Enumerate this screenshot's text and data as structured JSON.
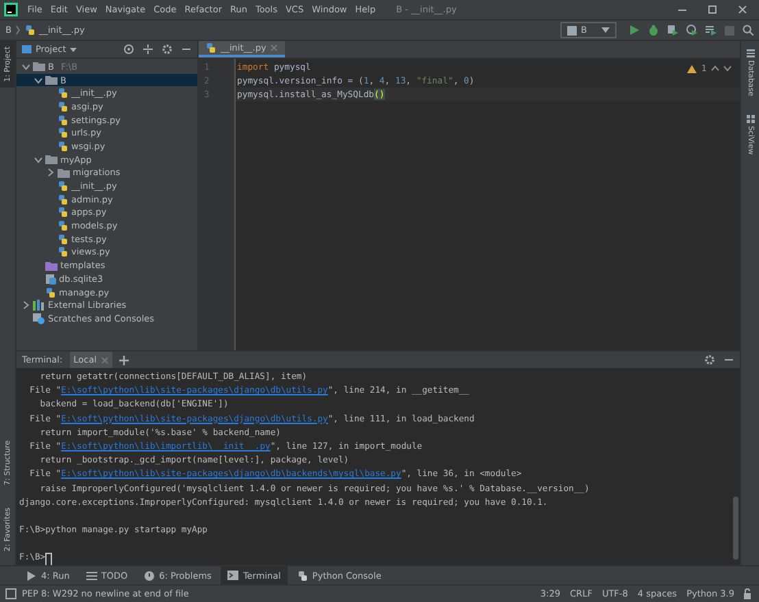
{
  "window": {
    "title": "B - __init__.py",
    "menu": [
      "File",
      "Edit",
      "View",
      "Navigate",
      "Code",
      "Refactor",
      "Run",
      "Tools",
      "VCS",
      "Window",
      "Help"
    ]
  },
  "breadcrumb": [
    {
      "label": "B",
      "kind": "folder"
    },
    {
      "label": "__init__.py",
      "kind": "python"
    }
  ],
  "run_config": {
    "label": "B"
  },
  "left_stripe": {
    "top": [
      {
        "label": "1: Project",
        "selected": true
      }
    ],
    "bottom": [
      {
        "label": "7: Structure",
        "selected": false
      },
      {
        "label": "2: Favorites",
        "selected": false
      }
    ]
  },
  "project": {
    "title": "Project",
    "tree": [
      {
        "label": "B",
        "hint": "F:\\B",
        "kind": "folder",
        "expanded": true,
        "selected": false,
        "children": [
          {
            "label": "B",
            "kind": "folder",
            "expanded": true,
            "selected": true,
            "children": [
              {
                "label": "__init__.py",
                "kind": "python",
                "selected": false
              },
              {
                "label": "asgi.py",
                "kind": "python",
                "selected": false
              },
              {
                "label": "settings.py",
                "kind": "python",
                "selected": false
              },
              {
                "label": "urls.py",
                "kind": "python",
                "selected": false
              },
              {
                "label": "wsgi.py",
                "kind": "python",
                "selected": false
              }
            ]
          },
          {
            "label": "myApp",
            "kind": "folder",
            "expanded": true,
            "selected": false,
            "children": [
              {
                "label": "migrations",
                "kind": "folder",
                "expanded": false,
                "selected": false
              },
              {
                "label": "__init__.py",
                "kind": "python",
                "selected": false
              },
              {
                "label": "admin.py",
                "kind": "python",
                "selected": false
              },
              {
                "label": "apps.py",
                "kind": "python",
                "selected": false
              },
              {
                "label": "models.py",
                "kind": "python",
                "selected": false
              },
              {
                "label": "tests.py",
                "kind": "python",
                "selected": false
              },
              {
                "label": "views.py",
                "kind": "python",
                "selected": false
              }
            ]
          },
          {
            "label": "templates",
            "kind": "templates",
            "selected": false
          },
          {
            "label": "db.sqlite3",
            "kind": "database",
            "selected": false
          },
          {
            "label": "manage.py",
            "kind": "python",
            "selected": false
          }
        ]
      },
      {
        "label": "External Libraries",
        "kind": "libraries",
        "expanded": false,
        "selected": false
      },
      {
        "label": "Scratches and Consoles",
        "kind": "scratches",
        "selected": false
      }
    ]
  },
  "editor": {
    "tabs": [
      {
        "label": "__init__.py",
        "selected": true
      }
    ],
    "warnings": "1",
    "lines": [
      {
        "number": "1",
        "current": false,
        "tokens": [
          {
            "text": "import",
            "kind": "keyword"
          },
          {
            "text": " pymysql",
            "kind": "plain"
          }
        ]
      },
      {
        "number": "2",
        "current": false,
        "tokens": [
          {
            "text": "pymysql.version_info = (",
            "kind": "plain"
          },
          {
            "text": "1",
            "kind": "number"
          },
          {
            "text": ", ",
            "kind": "plain"
          },
          {
            "text": "4",
            "kind": "number"
          },
          {
            "text": ", ",
            "kind": "plain"
          },
          {
            "text": "13",
            "kind": "number"
          },
          {
            "text": ", ",
            "kind": "plain"
          },
          {
            "text": "\"final\"",
            "kind": "string"
          },
          {
            "text": ", ",
            "kind": "plain"
          },
          {
            "text": "0",
            "kind": "number"
          },
          {
            "text": ")",
            "kind": "plain"
          }
        ]
      },
      {
        "number": "3",
        "current": true,
        "tokens": [
          {
            "text": "pymysql.install_as_MySQLdb",
            "kind": "plain"
          },
          {
            "text": "()",
            "kind": "brace"
          }
        ]
      }
    ]
  },
  "right_stripe": [
    {
      "label": "Database"
    },
    {
      "label": "SciView"
    }
  ],
  "terminal": {
    "title": "Terminal:",
    "tabs": [
      {
        "label": "Local",
        "selected": true
      }
    ],
    "lines": [
      {
        "kind": "output",
        "parts": [
          {
            "text": "    return getattr(connections[DEFAULT_DB_ALIAS], item)",
            "link": false
          }
        ]
      },
      {
        "kind": "output",
        "parts": [
          {
            "text": "  File \"",
            "link": false
          },
          {
            "text": "E:\\soft\\python\\lib\\site-packages\\django\\db\\utils.py",
            "link": true
          },
          {
            "text": "\", line 214, in __getitem__",
            "link": false
          }
        ]
      },
      {
        "kind": "output",
        "parts": [
          {
            "text": "    backend = load_backend(db['ENGINE'])",
            "link": false
          }
        ]
      },
      {
        "kind": "output",
        "parts": [
          {
            "text": "  File \"",
            "link": false
          },
          {
            "text": "E:\\soft\\python\\lib\\site-packages\\django\\db\\utils.py",
            "link": true
          },
          {
            "text": "\", line 111, in load_backend",
            "link": false
          }
        ]
      },
      {
        "kind": "output",
        "parts": [
          {
            "text": "    return import_module('%s.base' % backend_name)",
            "link": false
          }
        ]
      },
      {
        "kind": "output",
        "parts": [
          {
            "text": "  File \"",
            "link": false
          },
          {
            "text": "E:\\soft\\python\\lib\\importlib\\__init__.py",
            "link": true
          },
          {
            "text": "\", line 127, in import_module",
            "link": false
          }
        ]
      },
      {
        "kind": "output",
        "parts": [
          {
            "text": "    return _bootstrap._gcd_import(name[level:], package, level)",
            "link": false
          }
        ]
      },
      {
        "kind": "output",
        "parts": [
          {
            "text": "  File \"",
            "link": false
          },
          {
            "text": "E:\\soft\\python\\lib\\site-packages\\django\\db\\backends\\mysql\\base.py",
            "link": true
          },
          {
            "text": "\", line 36, in <module>",
            "link": false
          }
        ]
      },
      {
        "kind": "output",
        "parts": [
          {
            "text": "    raise ImproperlyConfigured('mysqlclient 1.4.0 or newer is required; you have %s.' % Database.__version__)",
            "link": false
          }
        ]
      },
      {
        "kind": "output",
        "parts": [
          {
            "text": "django.core.exceptions.ImproperlyConfigured: mysqlclient 1.4.0 or newer is required; you have 0.10.1.",
            "link": false
          }
        ]
      },
      {
        "kind": "blank"
      },
      {
        "kind": "output",
        "parts": [
          {
            "text": "F:\\B>python manage.py startapp myApp",
            "link": false
          }
        ]
      },
      {
        "kind": "blank"
      },
      {
        "kind": "prompt",
        "parts": [
          {
            "text": "F:\\B>",
            "link": false
          }
        ],
        "cursor": true
      }
    ]
  },
  "tool_tabs": [
    {
      "label": "4: Run",
      "kind": "run",
      "selected": false
    },
    {
      "label": "TODO",
      "kind": "todo",
      "selected": false
    },
    {
      "label": "6: Problems",
      "kind": "problems",
      "selected": false
    },
    {
      "label": "Terminal",
      "kind": "terminal",
      "selected": true
    },
    {
      "label": "Python Console",
      "kind": "console",
      "selected": false
    }
  ],
  "status": {
    "message": "PEP 8: W292 no newline at end of file",
    "items": [
      "3:29",
      "CRLF",
      "UTF-8",
      "4 spaces",
      "Python 3.9"
    ]
  }
}
